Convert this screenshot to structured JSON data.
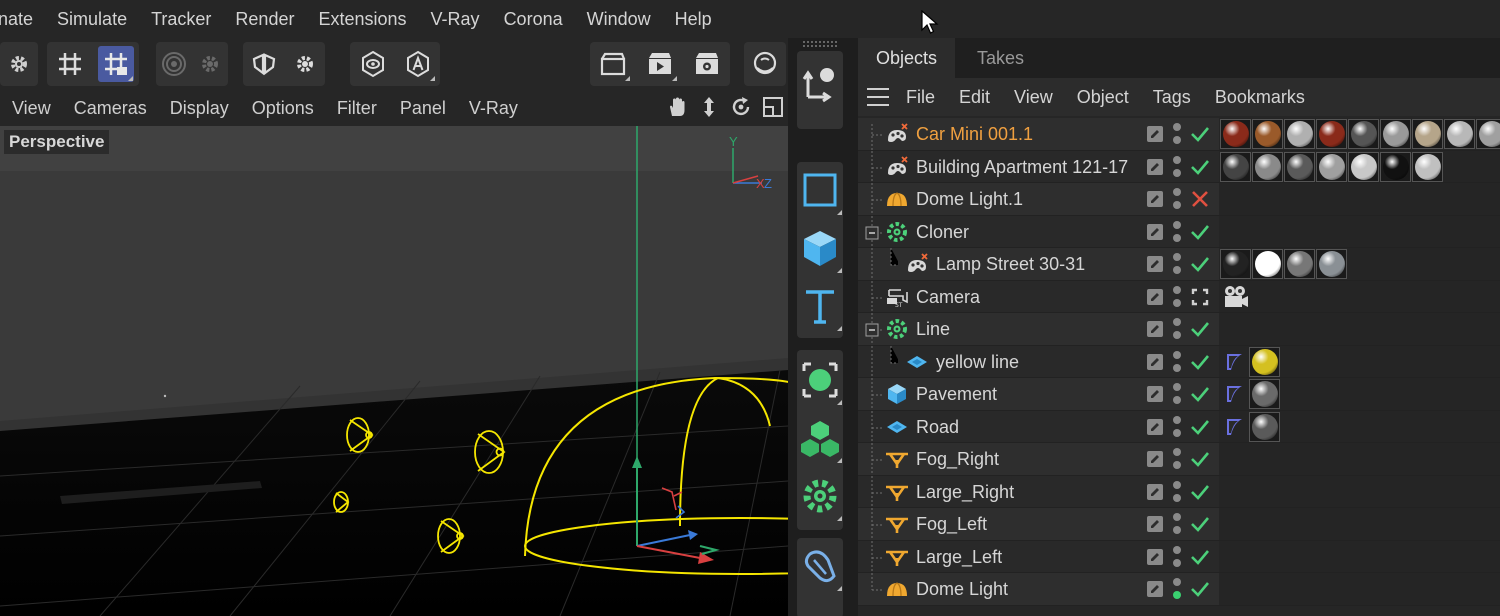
{
  "menubar": {
    "items": [
      "nate",
      "Simulate",
      "Tracker",
      "Render",
      "Extensions",
      "V-Ray",
      "Corona",
      "Window",
      "Help"
    ]
  },
  "viewport": {
    "menu": [
      "View",
      "Cameras",
      "Display",
      "Options",
      "Filter",
      "Panel",
      "V-Ray"
    ],
    "label": "Perspective",
    "axis_y": "Y",
    "axis_z": "Z",
    "axis_x": "X"
  },
  "object_manager": {
    "tabs": [
      "Objects",
      "Takes"
    ],
    "menu": [
      "File",
      "Edit",
      "View",
      "Object",
      "Tags",
      "Bookmarks"
    ],
    "objects": [
      {
        "name": "Car Mini 001.1",
        "icon": "xref-icon",
        "depth": 0,
        "selected": true,
        "state": "check",
        "tags": [
          "#8a2a1a",
          "#9a5a2a",
          "#b0b0b0",
          "#8a2a1a",
          "#555555",
          "#9a9a9a",
          "#b5a58a",
          "#b8b8b8",
          "#a0a0a0"
        ]
      },
      {
        "name": "Building Apartment 121-17",
        "icon": "xref-icon",
        "depth": 0,
        "selected": false,
        "state": "check",
        "tags": [
          "#444444",
          "#8a8a8a",
          "#5a5a5a",
          "#a0a0a0",
          "#c8c8c8",
          "#111111",
          "#c0c0c0"
        ]
      },
      {
        "name": "Dome Light.1",
        "icon": "dome-light-icon",
        "depth": 0,
        "selected": false,
        "state": "cross",
        "tags": []
      },
      {
        "name": "Cloner",
        "icon": "cloner-icon",
        "depth": 0,
        "selected": false,
        "state": "check",
        "expand": true,
        "tags": []
      },
      {
        "name": "Lamp Street 30-31",
        "icon": "xref-icon",
        "depth": 1,
        "selected": false,
        "state": "check",
        "tags": [
          "#222222",
          "#ffffff",
          "#777777",
          "#8a9095"
        ]
      },
      {
        "name": "Camera",
        "icon": "camera-icon",
        "depth": 0,
        "selected": false,
        "state": "focus",
        "tags": [
          "camera-tag"
        ]
      },
      {
        "name": "Line",
        "icon": "cloner-icon",
        "depth": 0,
        "selected": false,
        "state": "check",
        "expand": true,
        "tags": []
      },
      {
        "name": "yellow line",
        "icon": "plane-icon",
        "depth": 1,
        "selected": false,
        "state": "check",
        "tags": [
          "flag",
          "#d4c020"
        ]
      },
      {
        "name": "Pavement",
        "icon": "cube-icon",
        "depth": 0,
        "selected": false,
        "state": "check",
        "tags": [
          "flag",
          "#6a6a6a"
        ]
      },
      {
        "name": "Road",
        "icon": "plane-icon",
        "depth": 0,
        "selected": false,
        "state": "check",
        "tags": [
          "flag",
          "#5a5a5a"
        ]
      },
      {
        "name": "Fog_Right",
        "icon": "spot-light-icon",
        "depth": 0,
        "selected": false,
        "state": "check",
        "tags": []
      },
      {
        "name": "Large_Right",
        "icon": "spot-light-icon",
        "depth": 0,
        "selected": false,
        "state": "check",
        "tags": []
      },
      {
        "name": "Fog_Left",
        "icon": "spot-light-icon",
        "depth": 0,
        "selected": false,
        "state": "check",
        "tags": []
      },
      {
        "name": "Large_Left",
        "icon": "spot-light-icon",
        "depth": 0,
        "selected": false,
        "state": "check",
        "tags": []
      },
      {
        "name": "Dome Light",
        "icon": "dome-light-icon",
        "depth": 0,
        "selected": false,
        "state": "check",
        "tags": []
      }
    ]
  },
  "colors": {
    "accent": "#4a5aa0",
    "selected_text": "#f0a040",
    "check": "#4cd07a",
    "cross": "#e05040",
    "light_yellow": "#f5e600"
  }
}
